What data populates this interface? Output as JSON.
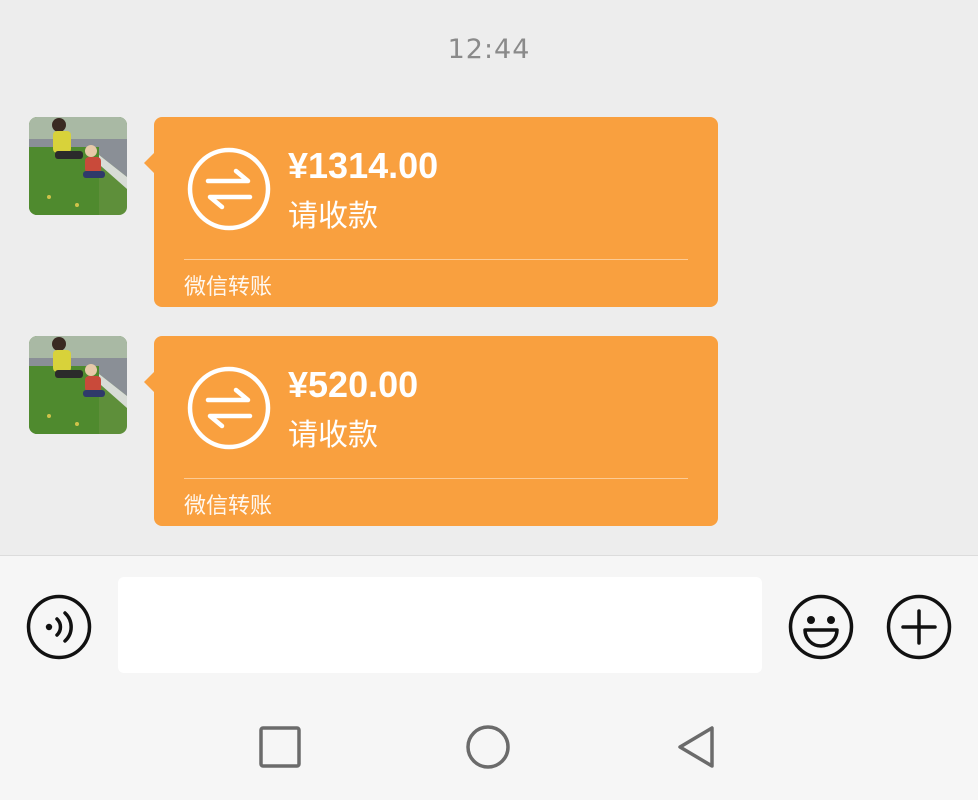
{
  "chat": {
    "timestamp": "12:44",
    "messages": [
      {
        "amount": "¥1314.00",
        "status": "请收款",
        "footer": "微信转账"
      },
      {
        "amount": "¥520.00",
        "status": "请收款",
        "footer": "微信转账"
      }
    ]
  },
  "input_bar": {
    "voice_icon": "voice-icon",
    "emoji_icon": "emoji-icon",
    "plus_icon": "plus-icon",
    "message_value": ""
  },
  "nav": {
    "recent_icon": "square-icon",
    "home_icon": "circle-icon",
    "back_icon": "triangle-back-icon"
  },
  "colors": {
    "bubble": "#f9a03f",
    "background": "#ededed"
  }
}
